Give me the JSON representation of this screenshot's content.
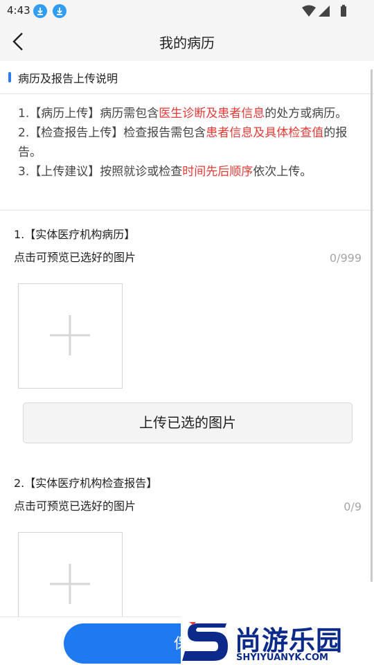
{
  "status_bar": {
    "time": "4:43"
  },
  "nav": {
    "title": "我的病历"
  },
  "section_heading": "病历及报告上传说明",
  "instructions": [
    {
      "prefix": "1.【病历上传】病历需包含",
      "highlight": "医生诊断及患者信息",
      "suffix": "的处方或病历。"
    },
    {
      "prefix": "2.【检查报告上传】检查报告需包含",
      "highlight": "患者信息及具体检查值",
      "suffix": "的报告。"
    },
    {
      "prefix": "3.【上传建议】按照就诊或检查",
      "highlight": "时间先后顺序",
      "suffix": "依次上传。"
    }
  ],
  "upload_sections": [
    {
      "title": "1.【实体医疗机构病历】",
      "hint": "点击可预览已选好的图片",
      "count": "0/999",
      "button": "上传已选的图片"
    },
    {
      "title": "2.【实体医疗机构检查报告】",
      "hint": "点击可预览已选好的图片",
      "count": "0/9"
    }
  ],
  "bottom": {
    "save_label": "保存"
  },
  "watermark": {
    "brand": "尚游乐园",
    "domain": "SHYIYUANYK.COM"
  },
  "colors": {
    "accent": "#1f7af2",
    "highlight": "#e53a36",
    "download_badge": "#2f9df3"
  },
  "icons": [
    "download-icon",
    "wifi-icon",
    "signal-icon",
    "battery-icon",
    "back-arrow-icon",
    "plus-icon"
  ]
}
